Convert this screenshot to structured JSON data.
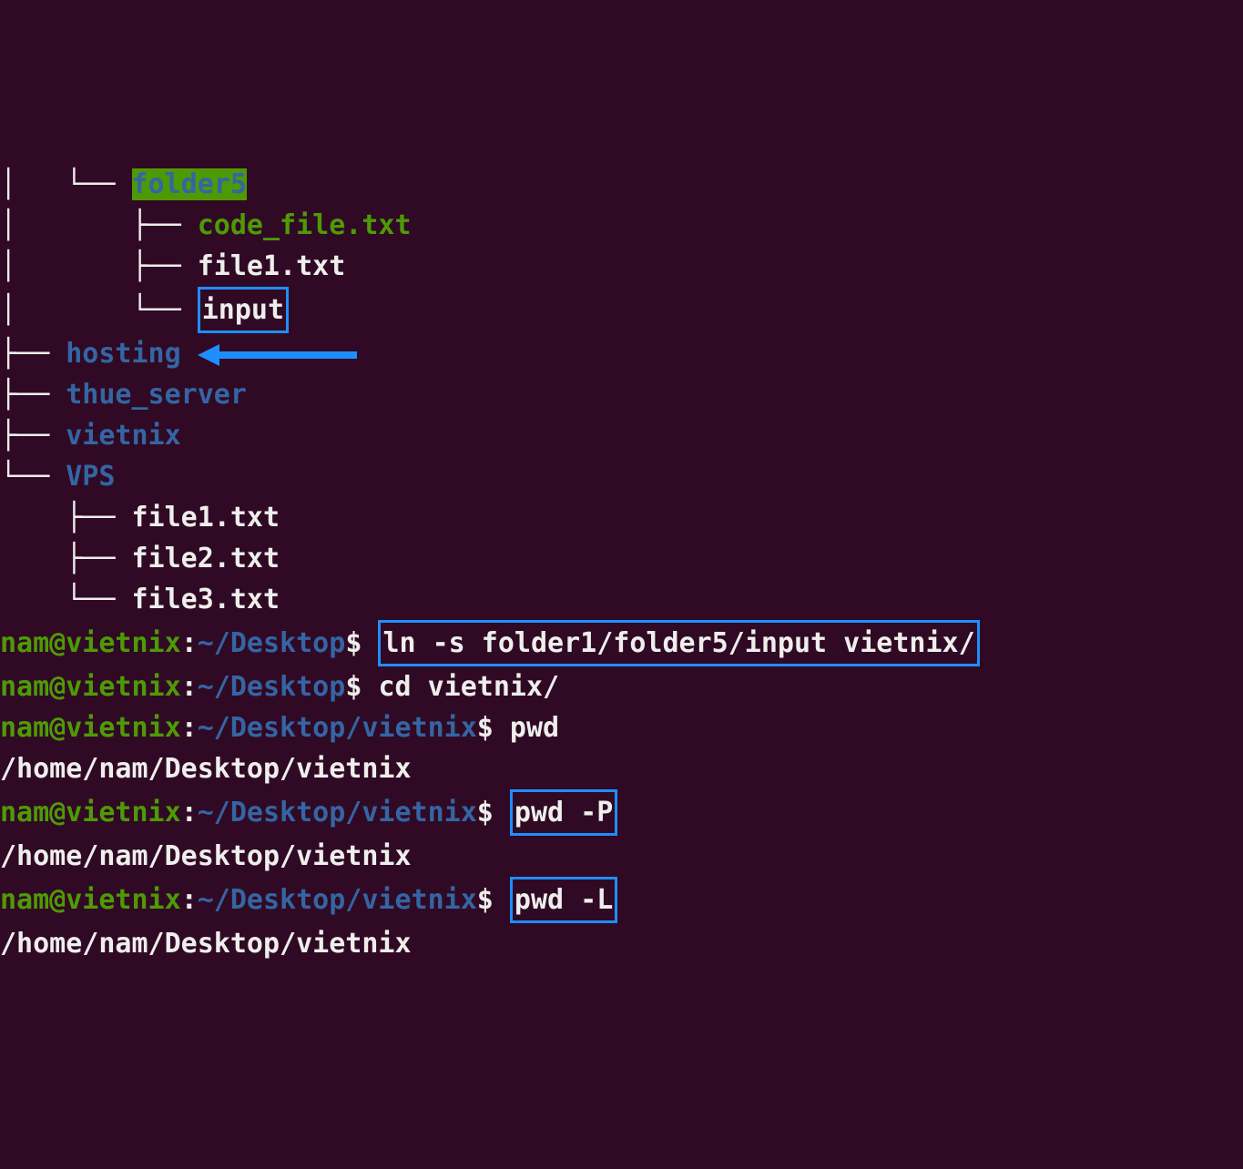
{
  "tree": {
    "folder5": "folder5",
    "code_file": "code_file.txt",
    "file1a": "file1.txt",
    "input": "input",
    "hosting": "hosting",
    "thue_server": "thue_server",
    "vietnix": "vietnix",
    "vps": "VPS",
    "file1b": "file1.txt",
    "file2": "file2.txt",
    "file3": "file3.txt"
  },
  "prompts": {
    "user": "nam@vietnix",
    "colon": ":",
    "path1": "~/Desktop",
    "path2": "~/Desktop/vietnix",
    "dollar": "$ "
  },
  "commands": {
    "ln": "ln -s folder1/folder5/input vietnix/",
    "cd": "cd vietnix/",
    "pwd": "pwd",
    "pwdP": "pwd -P",
    "pwdL": "pwd -L"
  },
  "output": {
    "home": "/home/nam/Desktop/vietnix"
  },
  "tree_chars": {
    "branch_v": "│   ",
    "branch_t": "├── ",
    "branch_l": "└── ",
    "space": "    "
  }
}
